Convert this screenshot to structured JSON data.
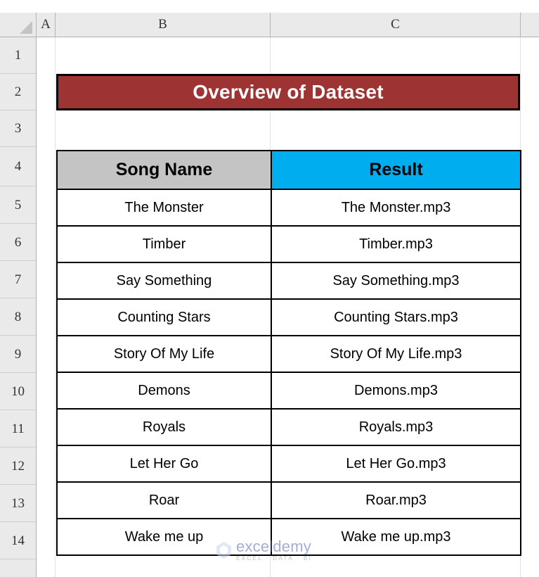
{
  "application": "spreadsheet",
  "grid": {
    "column_headers": [
      "A",
      "B",
      "C"
    ],
    "row_headers": [
      "1",
      "2",
      "3",
      "4",
      "5",
      "6",
      "7",
      "8",
      "9",
      "10",
      "11",
      "12",
      "13",
      "14"
    ],
    "select_all_icon": "select-all-triangle-icon"
  },
  "title_banner": {
    "text": "Overview of Dataset",
    "background_color": "#9D3333",
    "text_color": "#FFFFFF",
    "border_color": "#000000",
    "cell_range": "B2:C2"
  },
  "table": {
    "cell_range": "B4:C14",
    "headers": [
      {
        "label": "Song Name",
        "background_color": "#C4C4C4"
      },
      {
        "label": "Result",
        "background_color": "#00AEEF"
      }
    ],
    "rows": [
      {
        "song_name": "The Monster",
        "result": "The Monster.mp3"
      },
      {
        "song_name": "Timber",
        "result": "Timber.mp3"
      },
      {
        "song_name": "Say Something",
        "result": "Say Something.mp3"
      },
      {
        "song_name": "Counting Stars",
        "result": "Counting Stars.mp3"
      },
      {
        "song_name": "Story Of My Life",
        "result": "Story Of My Life.mp3"
      },
      {
        "song_name": "Demons",
        "result": "Demons.mp3"
      },
      {
        "song_name": "Royals",
        "result": "Royals.mp3"
      },
      {
        "song_name": "Let Her Go",
        "result": "Let Her Go.mp3"
      },
      {
        "song_name": "Roar",
        "result": "Roar.mp3"
      },
      {
        "song_name": "Wake me up",
        "result": "Wake me up.mp3"
      }
    ]
  },
  "watermark": {
    "name": "exceldemy",
    "tagline": "EXCEL · DATA · BI",
    "name_color": "#5B6BB5"
  }
}
